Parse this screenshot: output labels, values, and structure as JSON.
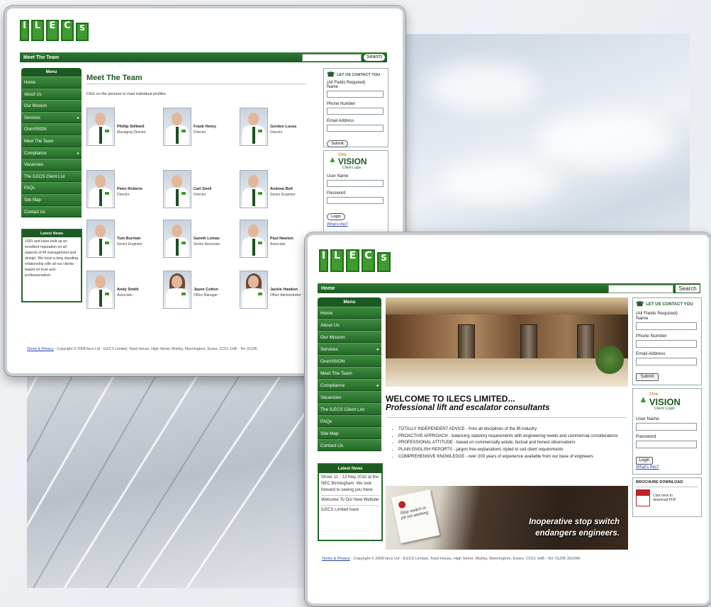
{
  "logo": [
    "I",
    "L",
    "E",
    "C",
    "S"
  ],
  "search_label": "Search",
  "team_page": {
    "bar_title": "Meet The Team",
    "heading": "Meet The Team",
    "intro": "Click on the pictures to read individual profiles",
    "members": [
      {
        "name": "Phillip Stillwell",
        "role": "Managing Director",
        "gender": "m"
      },
      {
        "name": "Frank Henry",
        "role": "Director",
        "gender": "m"
      },
      {
        "name": "Gordon Lucas",
        "role": "Director",
        "gender": "m"
      },
      {
        "name": "Peter Roberts",
        "role": "Director",
        "gender": "m"
      },
      {
        "name": "Carl Snell",
        "role": "Director",
        "gender": "m"
      },
      {
        "name": "Andrew Bell",
        "role": "Senior Engineer",
        "gender": "m"
      },
      {
        "name": "Tom Burman",
        "role": "Senior Engineer",
        "gender": "m"
      },
      {
        "name": "Gareth Lomax",
        "role": "Senior Associate",
        "gender": "m"
      },
      {
        "name": "Paul Newton",
        "role": "Associate",
        "gender": "m"
      },
      {
        "name": "Andy Smith",
        "role": "Associate",
        "gender": "m"
      },
      {
        "name": "Jayne Cotton",
        "role": "Office Manager",
        "gender": "f"
      },
      {
        "name": "Jackie Hawken",
        "role": "Office Administrator",
        "gender": "f"
      }
    ],
    "news_text": "1991 and have built up an excellent reputation on all aspects of lift management and design. We have a long standing relationship with all our clients based on trust and professionalism.",
    "footer_link": "Terms & Privacy",
    "footer_text": " - Copyright © 2008 Ilecs Ltd - ILECS Limited, Topsl House, High Street, Mistley, Manningtree, Essex, CO11 1HB - Tel: 01206"
  },
  "menu": {
    "head": "Menu",
    "items": [
      "Home",
      "About Us",
      "Our Mission",
      "Services",
      "OneVISION",
      "Meet The Team",
      "Compliance",
      "Vacancies",
      "The ILECS Client List",
      "FAQs",
      "Site Map",
      "Contact Us"
    ],
    "arrow_items": [
      "Services",
      "Compliance"
    ]
  },
  "news_head": "Latest News",
  "contact": {
    "title": "LET US CONTACT YOU",
    "required": "(All Fields Required)",
    "name": "Name",
    "phone": "Phone Number",
    "email": "Email Address",
    "submit": "Submit"
  },
  "onevision": {
    "one": "One",
    "vision": "VISION",
    "client_login": "Client Login",
    "username": "User Name",
    "password": "Password",
    "login": "Login",
    "whats_this": "What's this?"
  },
  "home_page": {
    "bar_title": "Home",
    "welcome_title": "WELCOME TO ILECS LIMITED...",
    "welcome_sub": "Professional lift and escalator consultants",
    "bullets": [
      "TOTALLY INDEPENDENT ADVICE - from all disciplines of the lift industry",
      "PROACTIVE APPROACH - balancing statutory requirements with engineering needs and commercial considerations",
      "PROFESSIONAL ATTITUDE - based on commercially astute, factual and honest observations",
      "PLAIN ENGLISH REPORTS - jargon free explanations styled to suit client requirements",
      "COMPREHENSIVE KNOWLEDGE - over 200 years of experience available from our base of engineers"
    ],
    "banner_line1": "Inoperative stop switch",
    "banner_line2": "endangers engineers.",
    "note_text": "Stop switch in pit not working",
    "news_items": [
      "Show, 11 - 13 May 2010 at the NEC Birmingham. We look forward to seeing you there",
      "Welcome To Our New Website",
      "ILECS Limited have"
    ],
    "brochure_title": "BROCHURE DOWNLOAD",
    "brochure_text": "Click here to download PDF",
    "footer_link": "Terms & Privacy",
    "footer_text": " - Copyright © 2008 Ilecs Ltd - ILECS Limited, Topsl House, High Street, Mistley, Manningtree, Essex, CO11 1HB - Tel: 01206 392349"
  },
  "colors": {
    "brand_green": "#1d5a23",
    "accent_green": "#3e9b2e",
    "link": "#2244aa"
  }
}
